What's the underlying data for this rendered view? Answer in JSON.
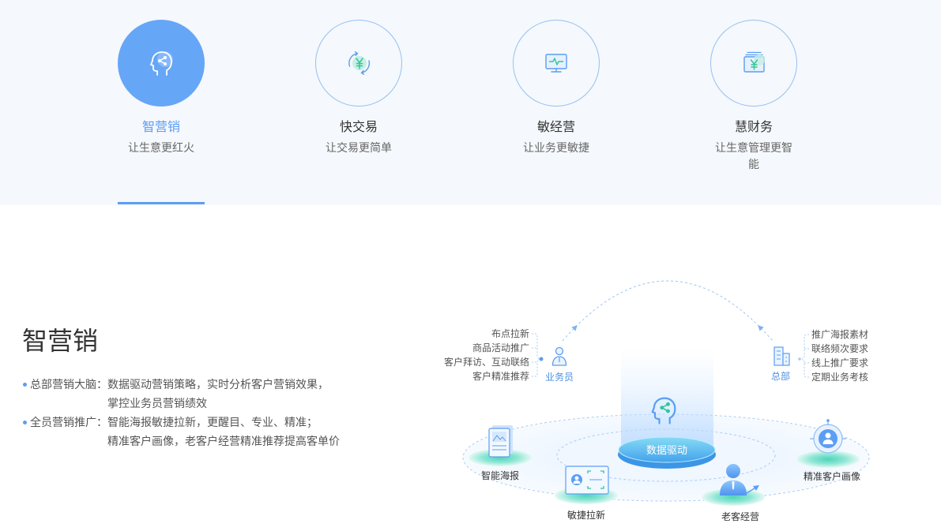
{
  "colors": {
    "accent": "#5b9ef4",
    "active_circle": "#66a6f6",
    "green": "#33c49b",
    "band": "#f5f8fc"
  },
  "tabs": [
    {
      "title": "智营销",
      "subtitle": "让生意更红火",
      "icon": "brain-share-icon",
      "active": true
    },
    {
      "title": "快交易",
      "subtitle": "让交易更简单",
      "icon": "yen-cycle-icon",
      "active": false
    },
    {
      "title": "敏经营",
      "subtitle": "让业务更敏捷",
      "icon": "monitor-pulse-icon",
      "active": false
    },
    {
      "title": "慧财务",
      "subtitle": "让生意管理更智能",
      "icon": "yen-ledger-icon",
      "active": false
    }
  ],
  "section": {
    "heading": "智营销",
    "bullets": [
      {
        "label": "总部营销大脑：",
        "lines": [
          "数据驱动营销策略，实时分析客户营销效果，",
          "掌控业务员营销绩效"
        ]
      },
      {
        "label": "全员营销推广：",
        "lines": [
          "智能海报敏捷拉新，更醒目、专业、精准；",
          "精准客户画像，老客户经营精准推荐提高客单价"
        ]
      }
    ]
  },
  "diagram": {
    "salesman": {
      "label": "业务员",
      "icon": "person-icon",
      "tasks": [
        "布点拉新",
        "商品活动推广",
        "客户拜访、互动联络",
        "客户精准推荐"
      ]
    },
    "headquarters": {
      "label": "总部",
      "icon": "building-icon",
      "tasks": [
        "推广海报素材",
        "联络频次要求",
        "线上推广要求",
        "定期业务考核"
      ]
    },
    "core": {
      "label": "数据驱动",
      "icon": "brain-share-icon"
    },
    "nodes": [
      {
        "label": "智能海报",
        "icon": "poster-icon"
      },
      {
        "label": "敏捷拉新",
        "icon": "scan-profile-icon"
      },
      {
        "label": "老客经营",
        "icon": "customer-icon"
      },
      {
        "label": "精准客户画像",
        "icon": "target-profile-icon"
      }
    ]
  }
}
